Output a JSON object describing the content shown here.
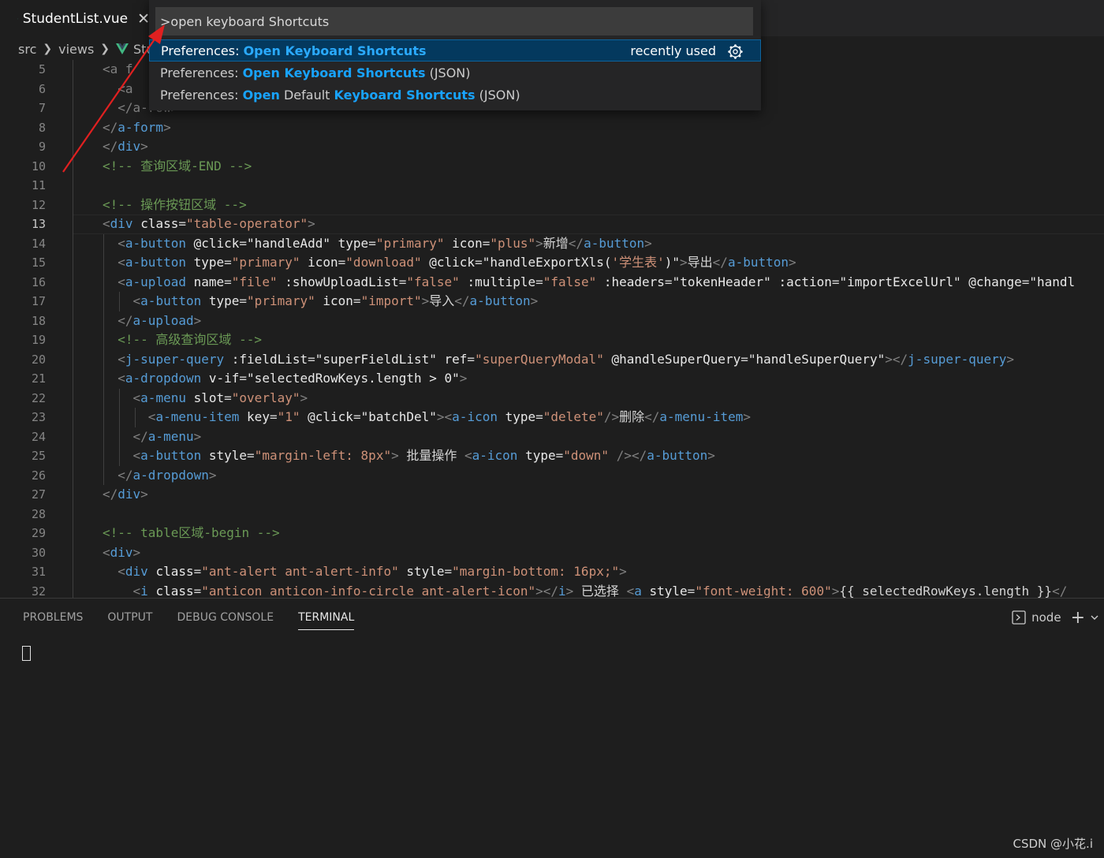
{
  "tab": {
    "title": "StudentList.vue",
    "close": "✕"
  },
  "breadcrumb": [
    "src",
    "views",
    "Stud"
  ],
  "palette": {
    "input_value": ">open keyboard Shortcuts",
    "items": [
      [
        {
          "t": "Preferences: ",
          "h": false
        },
        {
          "t": "Open Keyboard Shortcuts",
          "h": true
        }
      ],
      [
        {
          "t": "Preferences: ",
          "h": false
        },
        {
          "t": "Open Keyboard Shortcuts",
          "h": true
        },
        {
          "t": " (JSON)",
          "h": false
        }
      ],
      [
        {
          "t": "Preferences: ",
          "h": false
        },
        {
          "t": "Open",
          "h": true
        },
        {
          "t": " Default ",
          "h": false
        },
        {
          "t": "Keyboard Shortcuts",
          "h": true
        },
        {
          "t": " (JSON)",
          "h": false
        }
      ]
    ],
    "recently_used": "recently used"
  },
  "editor": {
    "active_line": 13,
    "lines": [
      {
        "n": "5",
        "s": [
          {
            "c": "br",
            "t": "<a f"
          }
        ]
      },
      {
        "n": "6",
        "s": [
          {
            "c": "br",
            "t": "  <a"
          }
        ]
      },
      {
        "n": "7",
        "s": [
          {
            "c": "br",
            "t": "  </a-row>"
          }
        ]
      },
      {
        "n": "8",
        "s": [
          {
            "c": "br",
            "t": "</"
          },
          {
            "c": "tag",
            "t": "a-form"
          },
          {
            "c": "br",
            "t": ">"
          }
        ]
      },
      {
        "n": "9",
        "s": [
          {
            "c": "br",
            "t": "</"
          },
          {
            "c": "tag",
            "t": "div"
          },
          {
            "c": "br",
            "t": ">"
          }
        ]
      },
      {
        "n": "10",
        "s": [
          {
            "c": "cmt",
            "t": "<!-- 查询区域-END -->"
          }
        ]
      },
      {
        "n": "11",
        "s": []
      },
      {
        "n": "12",
        "s": [
          {
            "c": "cmt",
            "t": "<!-- 操作按钮区域 -->"
          }
        ]
      },
      {
        "n": "13",
        "s": [
          {
            "c": "br",
            "t": "<"
          },
          {
            "c": "tag",
            "t": "div"
          },
          {
            "c": "txt",
            "t": " "
          },
          {
            "c": "attrw",
            "t": "class"
          },
          {
            "c": "txt",
            "t": "="
          },
          {
            "c": "str",
            "t": "\"table-operator\""
          },
          {
            "c": "br",
            "t": ">"
          }
        ]
      },
      {
        "n": "14",
        "s": [
          {
            "c": "br",
            "t": "  <"
          },
          {
            "c": "tag",
            "t": "a-button"
          },
          {
            "c": "txt",
            "t": " "
          },
          {
            "c": "attrw",
            "t": "@click"
          },
          {
            "c": "txt",
            "t": "="
          },
          {
            "c": "attrw",
            "t": "\"handleAdd\""
          },
          {
            "c": "txt",
            "t": " "
          },
          {
            "c": "attrw",
            "t": "type"
          },
          {
            "c": "txt",
            "t": "="
          },
          {
            "c": "str",
            "t": "\"primary\""
          },
          {
            "c": "txt",
            "t": " "
          },
          {
            "c": "attrw",
            "t": "icon"
          },
          {
            "c": "txt",
            "t": "="
          },
          {
            "c": "str",
            "t": "\"plus\""
          },
          {
            "c": "br",
            "t": ">"
          },
          {
            "c": "txt",
            "t": "新增"
          },
          {
            "c": "br",
            "t": "</"
          },
          {
            "c": "tag",
            "t": "a-button"
          },
          {
            "c": "br",
            "t": ">"
          }
        ]
      },
      {
        "n": "15",
        "s": [
          {
            "c": "br",
            "t": "  <"
          },
          {
            "c": "tag",
            "t": "a-button"
          },
          {
            "c": "txt",
            "t": " "
          },
          {
            "c": "attrw",
            "t": "type"
          },
          {
            "c": "txt",
            "t": "="
          },
          {
            "c": "str",
            "t": "\"primary\""
          },
          {
            "c": "txt",
            "t": " "
          },
          {
            "c": "attrw",
            "t": "icon"
          },
          {
            "c": "txt",
            "t": "="
          },
          {
            "c": "str",
            "t": "\"download\""
          },
          {
            "c": "txt",
            "t": " "
          },
          {
            "c": "attrw",
            "t": "@click"
          },
          {
            "c": "txt",
            "t": "="
          },
          {
            "c": "attrw",
            "t": "\"handleExportXls("
          },
          {
            "c": "str",
            "t": "'学生表'"
          },
          {
            "c": "attrw",
            "t": ")\""
          },
          {
            "c": "br",
            "t": ">"
          },
          {
            "c": "txt",
            "t": "导出"
          },
          {
            "c": "br",
            "t": "</"
          },
          {
            "c": "tag",
            "t": "a-button"
          },
          {
            "c": "br",
            "t": ">"
          }
        ]
      },
      {
        "n": "16",
        "s": [
          {
            "c": "br",
            "t": "  <"
          },
          {
            "c": "tag",
            "t": "a-upload"
          },
          {
            "c": "txt",
            "t": " "
          },
          {
            "c": "attrw",
            "t": "name"
          },
          {
            "c": "txt",
            "t": "="
          },
          {
            "c": "str",
            "t": "\"file\""
          },
          {
            "c": "txt",
            "t": " "
          },
          {
            "c": "attrw",
            "t": ":showUploadList"
          },
          {
            "c": "txt",
            "t": "="
          },
          {
            "c": "str",
            "t": "\"false\""
          },
          {
            "c": "txt",
            "t": " "
          },
          {
            "c": "attrw",
            "t": ":multiple"
          },
          {
            "c": "txt",
            "t": "="
          },
          {
            "c": "str",
            "t": "\"false\""
          },
          {
            "c": "txt",
            "t": " "
          },
          {
            "c": "attrw",
            "t": ":headers"
          },
          {
            "c": "txt",
            "t": "="
          },
          {
            "c": "attrw",
            "t": "\"tokenHeader\""
          },
          {
            "c": "txt",
            "t": " "
          },
          {
            "c": "attrw",
            "t": ":action"
          },
          {
            "c": "txt",
            "t": "="
          },
          {
            "c": "attrw",
            "t": "\"importExcelUrl\""
          },
          {
            "c": "txt",
            "t": " "
          },
          {
            "c": "attrw",
            "t": "@change"
          },
          {
            "c": "txt",
            "t": "="
          },
          {
            "c": "attrw",
            "t": "\"handl"
          }
        ]
      },
      {
        "n": "17",
        "s": [
          {
            "c": "br",
            "t": "    <"
          },
          {
            "c": "tag",
            "t": "a-button"
          },
          {
            "c": "txt",
            "t": " "
          },
          {
            "c": "attrw",
            "t": "type"
          },
          {
            "c": "txt",
            "t": "="
          },
          {
            "c": "str",
            "t": "\"primary\""
          },
          {
            "c": "txt",
            "t": " "
          },
          {
            "c": "attrw",
            "t": "icon"
          },
          {
            "c": "txt",
            "t": "="
          },
          {
            "c": "str",
            "t": "\"import\""
          },
          {
            "c": "br",
            "t": ">"
          },
          {
            "c": "txt",
            "t": "导入"
          },
          {
            "c": "br",
            "t": "</"
          },
          {
            "c": "tag",
            "t": "a-button"
          },
          {
            "c": "br",
            "t": ">"
          }
        ]
      },
      {
        "n": "18",
        "s": [
          {
            "c": "br",
            "t": "  </"
          },
          {
            "c": "tag",
            "t": "a-upload"
          },
          {
            "c": "br",
            "t": ">"
          }
        ]
      },
      {
        "n": "19",
        "s": [
          {
            "c": "cmt",
            "t": "  <!-- 高级查询区域 -->"
          }
        ]
      },
      {
        "n": "20",
        "s": [
          {
            "c": "br",
            "t": "  <"
          },
          {
            "c": "tag",
            "t": "j-super-query"
          },
          {
            "c": "txt",
            "t": " "
          },
          {
            "c": "attrw",
            "t": ":fieldList"
          },
          {
            "c": "txt",
            "t": "="
          },
          {
            "c": "attrw",
            "t": "\"superFieldList\""
          },
          {
            "c": "txt",
            "t": " "
          },
          {
            "c": "attrw",
            "t": "ref"
          },
          {
            "c": "txt",
            "t": "="
          },
          {
            "c": "str",
            "t": "\"superQueryModal\""
          },
          {
            "c": "txt",
            "t": " "
          },
          {
            "c": "attrw",
            "t": "@handleSuperQuery"
          },
          {
            "c": "txt",
            "t": "="
          },
          {
            "c": "attrw",
            "t": "\"handleSuperQuery\""
          },
          {
            "c": "br",
            "t": "></"
          },
          {
            "c": "tag",
            "t": "j-super-query"
          },
          {
            "c": "br",
            "t": ">"
          }
        ]
      },
      {
        "n": "21",
        "s": [
          {
            "c": "br",
            "t": "  <"
          },
          {
            "c": "tag",
            "t": "a-dropdown"
          },
          {
            "c": "txt",
            "t": " "
          },
          {
            "c": "attrw",
            "t": "v-if"
          },
          {
            "c": "txt",
            "t": "="
          },
          {
            "c": "attrw",
            "t": "\"selectedRowKeys.length > 0\""
          },
          {
            "c": "br",
            "t": ">"
          }
        ]
      },
      {
        "n": "22",
        "s": [
          {
            "c": "br",
            "t": "    <"
          },
          {
            "c": "tag",
            "t": "a-menu"
          },
          {
            "c": "txt",
            "t": " "
          },
          {
            "c": "attrw",
            "t": "slot"
          },
          {
            "c": "txt",
            "t": "="
          },
          {
            "c": "str",
            "t": "\"overlay\""
          },
          {
            "c": "br",
            "t": ">"
          }
        ]
      },
      {
        "n": "23",
        "s": [
          {
            "c": "br",
            "t": "      <"
          },
          {
            "c": "tag",
            "t": "a-menu-item"
          },
          {
            "c": "txt",
            "t": " "
          },
          {
            "c": "attrw",
            "t": "key"
          },
          {
            "c": "txt",
            "t": "="
          },
          {
            "c": "str",
            "t": "\"1\""
          },
          {
            "c": "txt",
            "t": " "
          },
          {
            "c": "attrw",
            "t": "@click"
          },
          {
            "c": "txt",
            "t": "="
          },
          {
            "c": "attrw",
            "t": "\"batchDel\""
          },
          {
            "c": "br",
            "t": "><"
          },
          {
            "c": "tag",
            "t": "a-icon"
          },
          {
            "c": "txt",
            "t": " "
          },
          {
            "c": "attrw",
            "t": "type"
          },
          {
            "c": "txt",
            "t": "="
          },
          {
            "c": "str",
            "t": "\"delete\""
          },
          {
            "c": "br",
            "t": "/>"
          },
          {
            "c": "txt",
            "t": "删除"
          },
          {
            "c": "br",
            "t": "</"
          },
          {
            "c": "tag",
            "t": "a-menu-item"
          },
          {
            "c": "br",
            "t": ">"
          }
        ]
      },
      {
        "n": "24",
        "s": [
          {
            "c": "br",
            "t": "    </"
          },
          {
            "c": "tag",
            "t": "a-menu"
          },
          {
            "c": "br",
            "t": ">"
          }
        ]
      },
      {
        "n": "25",
        "s": [
          {
            "c": "br",
            "t": "    <"
          },
          {
            "c": "tag",
            "t": "a-button"
          },
          {
            "c": "txt",
            "t": " "
          },
          {
            "c": "attrw",
            "t": "style"
          },
          {
            "c": "txt",
            "t": "="
          },
          {
            "c": "str",
            "t": "\"margin-left: 8px\""
          },
          {
            "c": "br",
            "t": ">"
          },
          {
            "c": "txt",
            "t": " 批量操作 "
          },
          {
            "c": "br",
            "t": "<"
          },
          {
            "c": "tag",
            "t": "a-icon"
          },
          {
            "c": "txt",
            "t": " "
          },
          {
            "c": "attrw",
            "t": "type"
          },
          {
            "c": "txt",
            "t": "="
          },
          {
            "c": "str",
            "t": "\"down\""
          },
          {
            "c": "txt",
            "t": " "
          },
          {
            "c": "br",
            "t": "/></"
          },
          {
            "c": "tag",
            "t": "a-button"
          },
          {
            "c": "br",
            "t": ">"
          }
        ]
      },
      {
        "n": "26",
        "s": [
          {
            "c": "br",
            "t": "  </"
          },
          {
            "c": "tag",
            "t": "a-dropdown"
          },
          {
            "c": "br",
            "t": ">"
          }
        ]
      },
      {
        "n": "27",
        "s": [
          {
            "c": "br",
            "t": "</"
          },
          {
            "c": "tag",
            "t": "div"
          },
          {
            "c": "br",
            "t": ">"
          }
        ]
      },
      {
        "n": "28",
        "s": []
      },
      {
        "n": "29",
        "s": [
          {
            "c": "cmt",
            "t": "<!-- table区域-begin -->"
          }
        ]
      },
      {
        "n": "30",
        "s": [
          {
            "c": "br",
            "t": "<"
          },
          {
            "c": "tag",
            "t": "div"
          },
          {
            "c": "br",
            "t": ">"
          }
        ]
      },
      {
        "n": "31",
        "s": [
          {
            "c": "br",
            "t": "  <"
          },
          {
            "c": "tag",
            "t": "div"
          },
          {
            "c": "txt",
            "t": " "
          },
          {
            "c": "attrw",
            "t": "class"
          },
          {
            "c": "txt",
            "t": "="
          },
          {
            "c": "str",
            "t": "\"ant-alert ant-alert-info\""
          },
          {
            "c": "txt",
            "t": " "
          },
          {
            "c": "attrw",
            "t": "style"
          },
          {
            "c": "txt",
            "t": "="
          },
          {
            "c": "str",
            "t": "\"margin-bottom: 16px;\""
          },
          {
            "c": "br",
            "t": ">"
          }
        ]
      },
      {
        "n": "32",
        "s": [
          {
            "c": "br",
            "t": "    <"
          },
          {
            "c": "tag",
            "t": "i"
          },
          {
            "c": "txt",
            "t": " "
          },
          {
            "c": "attrw",
            "t": "class"
          },
          {
            "c": "txt",
            "t": "="
          },
          {
            "c": "str",
            "t": "\"anticon anticon-info-circle ant-alert-icon\""
          },
          {
            "c": "br",
            "t": "></"
          },
          {
            "c": "tag",
            "t": "i"
          },
          {
            "c": "br",
            "t": ">"
          },
          {
            "c": "txt",
            "t": " 已选择 "
          },
          {
            "c": "br",
            "t": "<"
          },
          {
            "c": "tag",
            "t": "a"
          },
          {
            "c": "txt",
            "t": " "
          },
          {
            "c": "attrw",
            "t": "style"
          },
          {
            "c": "txt",
            "t": "="
          },
          {
            "c": "str",
            "t": "\"font-weight: 600\""
          },
          {
            "c": "br",
            "t": ">"
          },
          {
            "c": "txt",
            "t": "{{ selectedRowKeys.length }}"
          },
          {
            "c": "br",
            "t": "</"
          }
        ]
      }
    ]
  },
  "panel": {
    "tabs": [
      "PROBLEMS",
      "OUTPUT",
      "DEBUG CONSOLE",
      "TERMINAL"
    ],
    "active_tab": "TERMINAL",
    "terminal_name": "node",
    "plus": "+"
  },
  "watermark": "CSDN @小花.i",
  "colors": {
    "accent": "#0e639c",
    "highlight": "#18a3ff",
    "annotation_arrow": "#e02020"
  }
}
